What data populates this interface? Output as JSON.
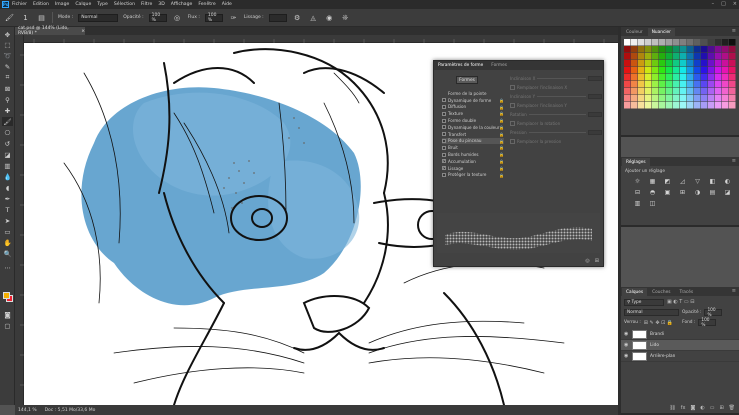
{
  "menubar": {
    "items": [
      "Fichier",
      "Edition",
      "Image",
      "Calque",
      "Type",
      "Sélection",
      "Filtre",
      "3D",
      "Affichage",
      "Fenêtre",
      "Aide"
    ],
    "controls": [
      "–",
      "□",
      "×"
    ]
  },
  "options": {
    "mode_label": "Mode :",
    "mode_value": "Normal",
    "opacity_label": "Opacité :",
    "opacity_value": "100 %",
    "flux_label": "Flux :",
    "flux_value": "100 %",
    "lissage_label": "Lissage :",
    "brush_size": "1"
  },
  "document": {
    "tab_title": "cat.psd @ 144% (Lido, RVB/8) *",
    "tab_close": "×"
  },
  "status": {
    "zoom": "144,1 %",
    "doc_info": "Doc : 5,51 Mo/33,6 Mo"
  },
  "brush_panel": {
    "tabs": [
      "Paramètres de forme",
      "Formes"
    ],
    "formes_button": "Formes",
    "items": [
      {
        "label": "Forme de la pointe",
        "checkbox": false,
        "checked": false,
        "lock": false
      },
      {
        "label": "Dynamique de forme",
        "checkbox": true,
        "checked": false,
        "lock": true
      },
      {
        "label": "Diffusion",
        "checkbox": true,
        "checked": false,
        "lock": true
      },
      {
        "label": "Texture",
        "checkbox": true,
        "checked": false,
        "lock": true
      },
      {
        "label": "Forme double",
        "checkbox": true,
        "checked": false,
        "lock": true
      },
      {
        "label": "Dynamique de la couleur",
        "checkbox": true,
        "checked": false,
        "lock": true
      },
      {
        "label": "Transfert",
        "checkbox": true,
        "checked": false,
        "lock": true
      },
      {
        "label": "Pose du pinceau",
        "checkbox": true,
        "checked": false,
        "lock": true
      },
      {
        "label": "Bruit",
        "checkbox": true,
        "checked": false,
        "lock": true
      },
      {
        "label": "Bords humides",
        "checkbox": true,
        "checked": false,
        "lock": true
      },
      {
        "label": "Accumulation",
        "checkbox": true,
        "checked": true,
        "lock": true
      },
      {
        "label": "Lissage",
        "checkbox": true,
        "checked": true,
        "lock": true
      },
      {
        "label": "Protéger la texture",
        "checkbox": true,
        "checked": false,
        "lock": true
      }
    ],
    "right_rows": [
      "Inclinaison X",
      "Remplacer l'inclinaison X",
      "Inclinaison Y",
      "Remplacer l'inclinaison Y",
      "Rotation",
      "Remplacer la rotation",
      "Pression",
      "Remplacer la pression"
    ]
  },
  "swatches_panel": {
    "tabs": [
      "Couleur",
      "Nuancier"
    ]
  },
  "adjust_panel": {
    "tabs": [
      "Réglages"
    ],
    "subtitle": "Ajouter un réglage",
    "icons": [
      "☼",
      "▦",
      "◩",
      "◿",
      "▽",
      "◧",
      "◐",
      "⊟",
      "◓",
      "▣",
      "⊞",
      "◑",
      "▤",
      "◪",
      "▥",
      "◫"
    ]
  },
  "layers_panel": {
    "tabs": [
      "Calques",
      "Couches",
      "Tracés"
    ],
    "filter_label": "Type",
    "blend_mode": "Normal",
    "opacity_label": "Opacité :",
    "opacity_value": "100 %",
    "lock_label": "Verrou :",
    "fill_label": "Fond :",
    "fill_value": "100 %",
    "layers": [
      {
        "name": "Brandi",
        "active": false
      },
      {
        "name": "Lido",
        "active": true
      },
      {
        "name": "Arrière-plan",
        "active": false
      }
    ]
  },
  "colors": {
    "fg": "#f5b000",
    "bg": "#e22233",
    "watercolor": "#4d96c8"
  }
}
